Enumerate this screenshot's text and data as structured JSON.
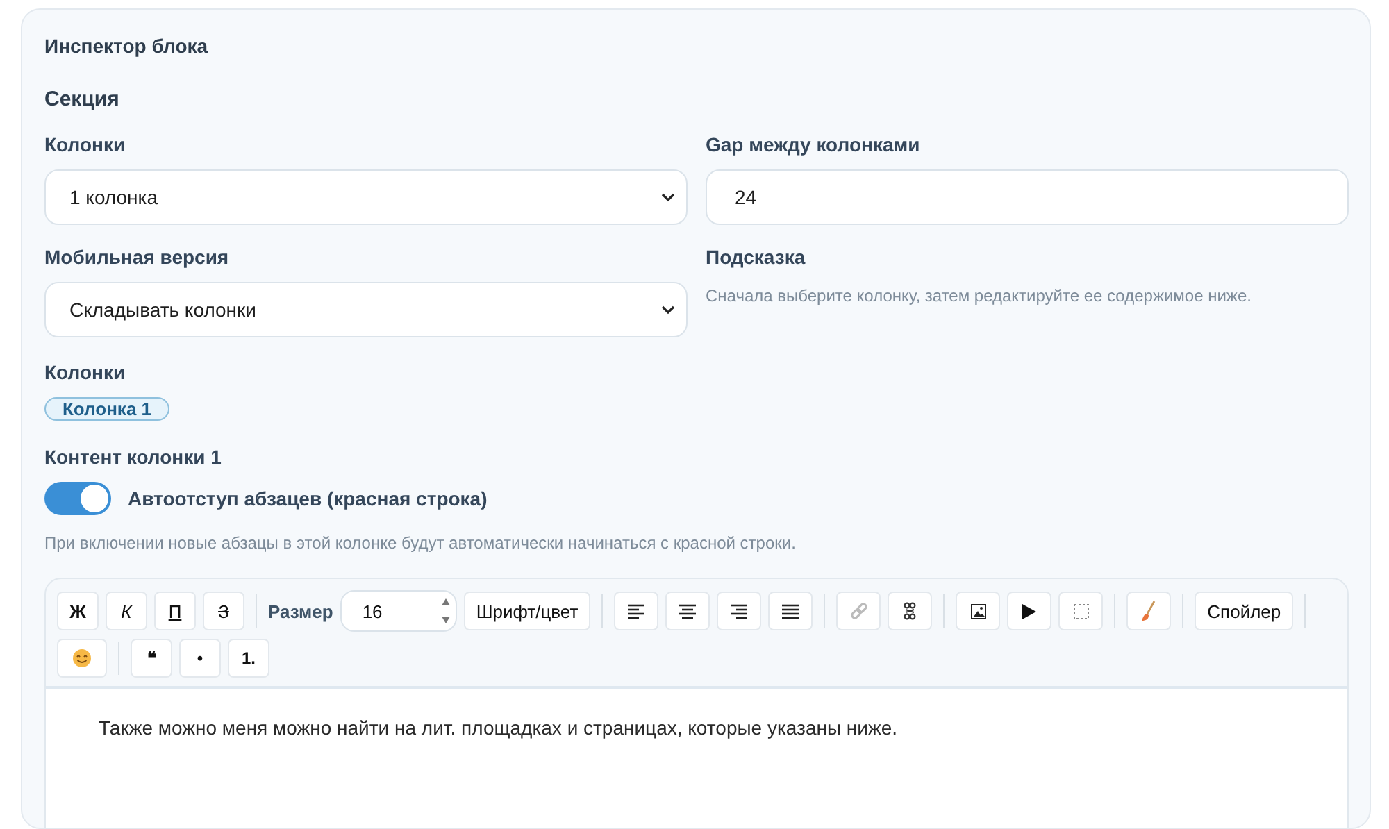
{
  "title": "Инспектор блока",
  "section": "Секция",
  "columns_select": {
    "label": "Колонки",
    "value": "1 колонка"
  },
  "gap": {
    "label": "Gap между колонками",
    "value": "24"
  },
  "mobile_select": {
    "label": "Мобильная версия",
    "value": "Складывать колонки"
  },
  "hint": {
    "label": "Подсказка",
    "text": "Сначала выберите колонку, затем редактируйте ее содержимое ниже."
  },
  "column_tabs": {
    "label": "Колонки",
    "items": [
      {
        "label": "Колонка 1",
        "selected": true
      }
    ]
  },
  "content": {
    "label": "Контент колонки 1",
    "auto_indent": {
      "label": "Автоотступ абзацев (красная строка)",
      "on": true
    },
    "note": "При включении новые абзацы в этой колонке будут автоматически начинаться с красной строки.",
    "toolbar": [
      [
        {
          "kind": "bold",
          "label": "Ж"
        },
        {
          "kind": "italic",
          "label": "К"
        },
        {
          "kind": "underline",
          "label": "П"
        },
        {
          "kind": "strike",
          "label": "З"
        },
        {
          "kind": "separator"
        },
        {
          "kind": "caption",
          "label": "Размер"
        },
        {
          "kind": "number",
          "value": "16"
        },
        {
          "kind": "button",
          "label": "Шрифт/цвет"
        },
        {
          "kind": "separator"
        },
        {
          "kind": "alignleft"
        },
        {
          "kind": "aligncenter"
        },
        {
          "kind": "alignright"
        },
        {
          "kind": "justify"
        },
        {
          "kind": "separator"
        },
        {
          "kind": "link"
        },
        {
          "kind": "unlink"
        },
        {
          "kind": "separator"
        },
        {
          "kind": "image"
        },
        {
          "kind": "play"
        },
        {
          "kind": "frame"
        },
        {
          "kind": "separator"
        },
        {
          "kind": "brush"
        },
        {
          "kind": "separator"
        },
        {
          "kind": "button",
          "label": "Спойлер"
        },
        {
          "kind": "separator"
        }
      ],
      [
        {
          "kind": "emoji"
        },
        {
          "kind": "separator"
        },
        {
          "kind": "char",
          "label": "❝"
        },
        {
          "kind": "char",
          "label": "•"
        },
        {
          "kind": "char",
          "label": "1."
        }
      ]
    ],
    "text": "Также можно меня можно найти на лит. площадках и страницах, которые указаны ниже."
  }
}
